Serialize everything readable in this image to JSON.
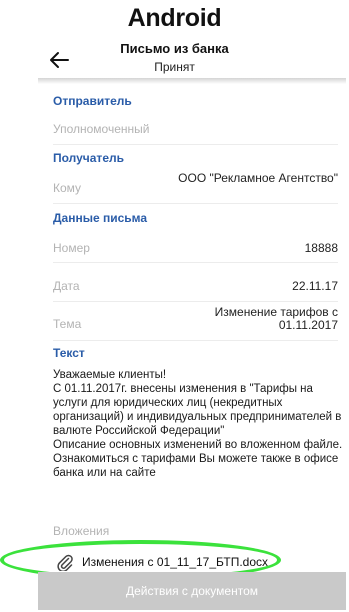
{
  "platform_label": "Android",
  "header": {
    "title": "Письмо из банка",
    "status": "Принят"
  },
  "sender": {
    "section_title": "Отправитель",
    "role": "Уполномоченный"
  },
  "recipient": {
    "section_title": "Получатель",
    "to_label": "Кому",
    "to_value": "ООО \"Рекламное Агентство\""
  },
  "letter_data": {
    "section_title": "Данные письма",
    "number_label": "Номер",
    "number_value": "18888",
    "date_label": "Дата",
    "date_value": "22.11.17",
    "subject_label": "Тема",
    "subject_value": "Изменение тарифов с 01.11.2017"
  },
  "text": {
    "section_title": "Текст",
    "body": "Уважаемые клиенты!\nС 01.11.2017г. внесены изменения в \"Тарифы на услуги для юридических лиц (некредитных организаций) и индивидуальных предпринимателей в валюте Российской Федерации\"\nОписание основных изменений во вложенном файле.\nОзнакомиться с тарифами Вы можете также в офисе банка или на сайте"
  },
  "attachments": {
    "label": "Вложения",
    "items": [
      {
        "name": "Изменения с 01_11_17_БТП.docx",
        "icon": "paperclip-icon"
      }
    ]
  },
  "actions": {
    "document_actions_label": "Действия с документом"
  },
  "colors": {
    "section_title": "#2a5ca8",
    "muted_label": "#b3b3b3",
    "highlight": "#3be23c",
    "action_bar": "#c9c9c9"
  }
}
